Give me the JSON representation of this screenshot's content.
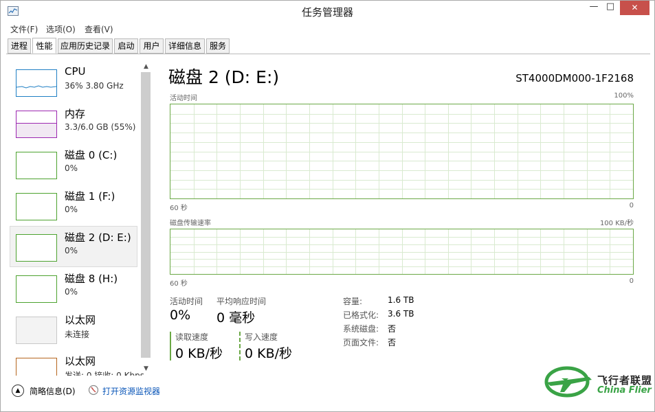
{
  "window": {
    "title": "任务管理器"
  },
  "title_buttons": {
    "minimize": "—",
    "maximize": "□",
    "close": "✕"
  },
  "menu": [
    "文件(F)",
    "选项(O)",
    "查看(V)"
  ],
  "tabs": [
    "进程",
    "性能",
    "应用历史记录",
    "启动",
    "用户",
    "详细信息",
    "服务"
  ],
  "active_tab": "性能",
  "sidebar": {
    "items": [
      {
        "name": "CPU",
        "sub": "36%  3.80 GHz",
        "color": "#1f7fc4"
      },
      {
        "name": "内存",
        "sub": "3.3/6.0 GB (55%)",
        "color": "#9c27b0"
      },
      {
        "name": "磁盘 0 (C:)",
        "sub": "0%",
        "color": "#4ca22e"
      },
      {
        "name": "磁盘 1 (F:)",
        "sub": "0%",
        "color": "#4ca22e"
      },
      {
        "name": "磁盘 2 (D: E:)",
        "sub": "0%",
        "color": "#4ca22e"
      },
      {
        "name": "磁盘 8 (H:)",
        "sub": "0%",
        "color": "#4ca22e"
      },
      {
        "name": "以太网",
        "sub": "未连接",
        "color": "#c8c8c8"
      },
      {
        "name": "以太网",
        "sub": "发送: 0  接收: 0 Kbps",
        "color": "#b5651d"
      }
    ],
    "selected_index": 4,
    "cpu_usage_percent": 36,
    "memory_usage_percent": 55
  },
  "detail": {
    "title": "磁盘 2 (D: E:)",
    "model": "ST4000DM000-1F2168",
    "graph1": {
      "label": "活动时间",
      "max": "100%",
      "time": "60 秒",
      "zero": "0"
    },
    "graph2": {
      "label": "磁盘传输速率",
      "max": "100 KB/秒",
      "time": "60 秒",
      "zero": "0"
    },
    "stats": {
      "active_time_label": "活动时间",
      "active_time_value": "0%",
      "response_label": "平均响应时间",
      "response_value": "0 毫秒",
      "read_label": "读取速度",
      "read_value": "0 KB/秒",
      "write_label": "写入速度",
      "write_value": "0 KB/秒"
    },
    "properties": [
      {
        "key": "容量:",
        "value": "1.6 TB"
      },
      {
        "key": "已格式化:",
        "value": "3.6 TB"
      },
      {
        "key": "系统磁盘:",
        "value": "否"
      },
      {
        "key": "页面文件:",
        "value": "否"
      }
    ]
  },
  "footer": {
    "summary": "简略信息(D)",
    "open_monitor": "打开资源监视器"
  },
  "watermark": {
    "line1": "飞行者联盟",
    "line2": "China Flier"
  },
  "colors": {
    "disk_green": "#6aa845",
    "link": "#0a56b8",
    "close": "#c7504b"
  }
}
